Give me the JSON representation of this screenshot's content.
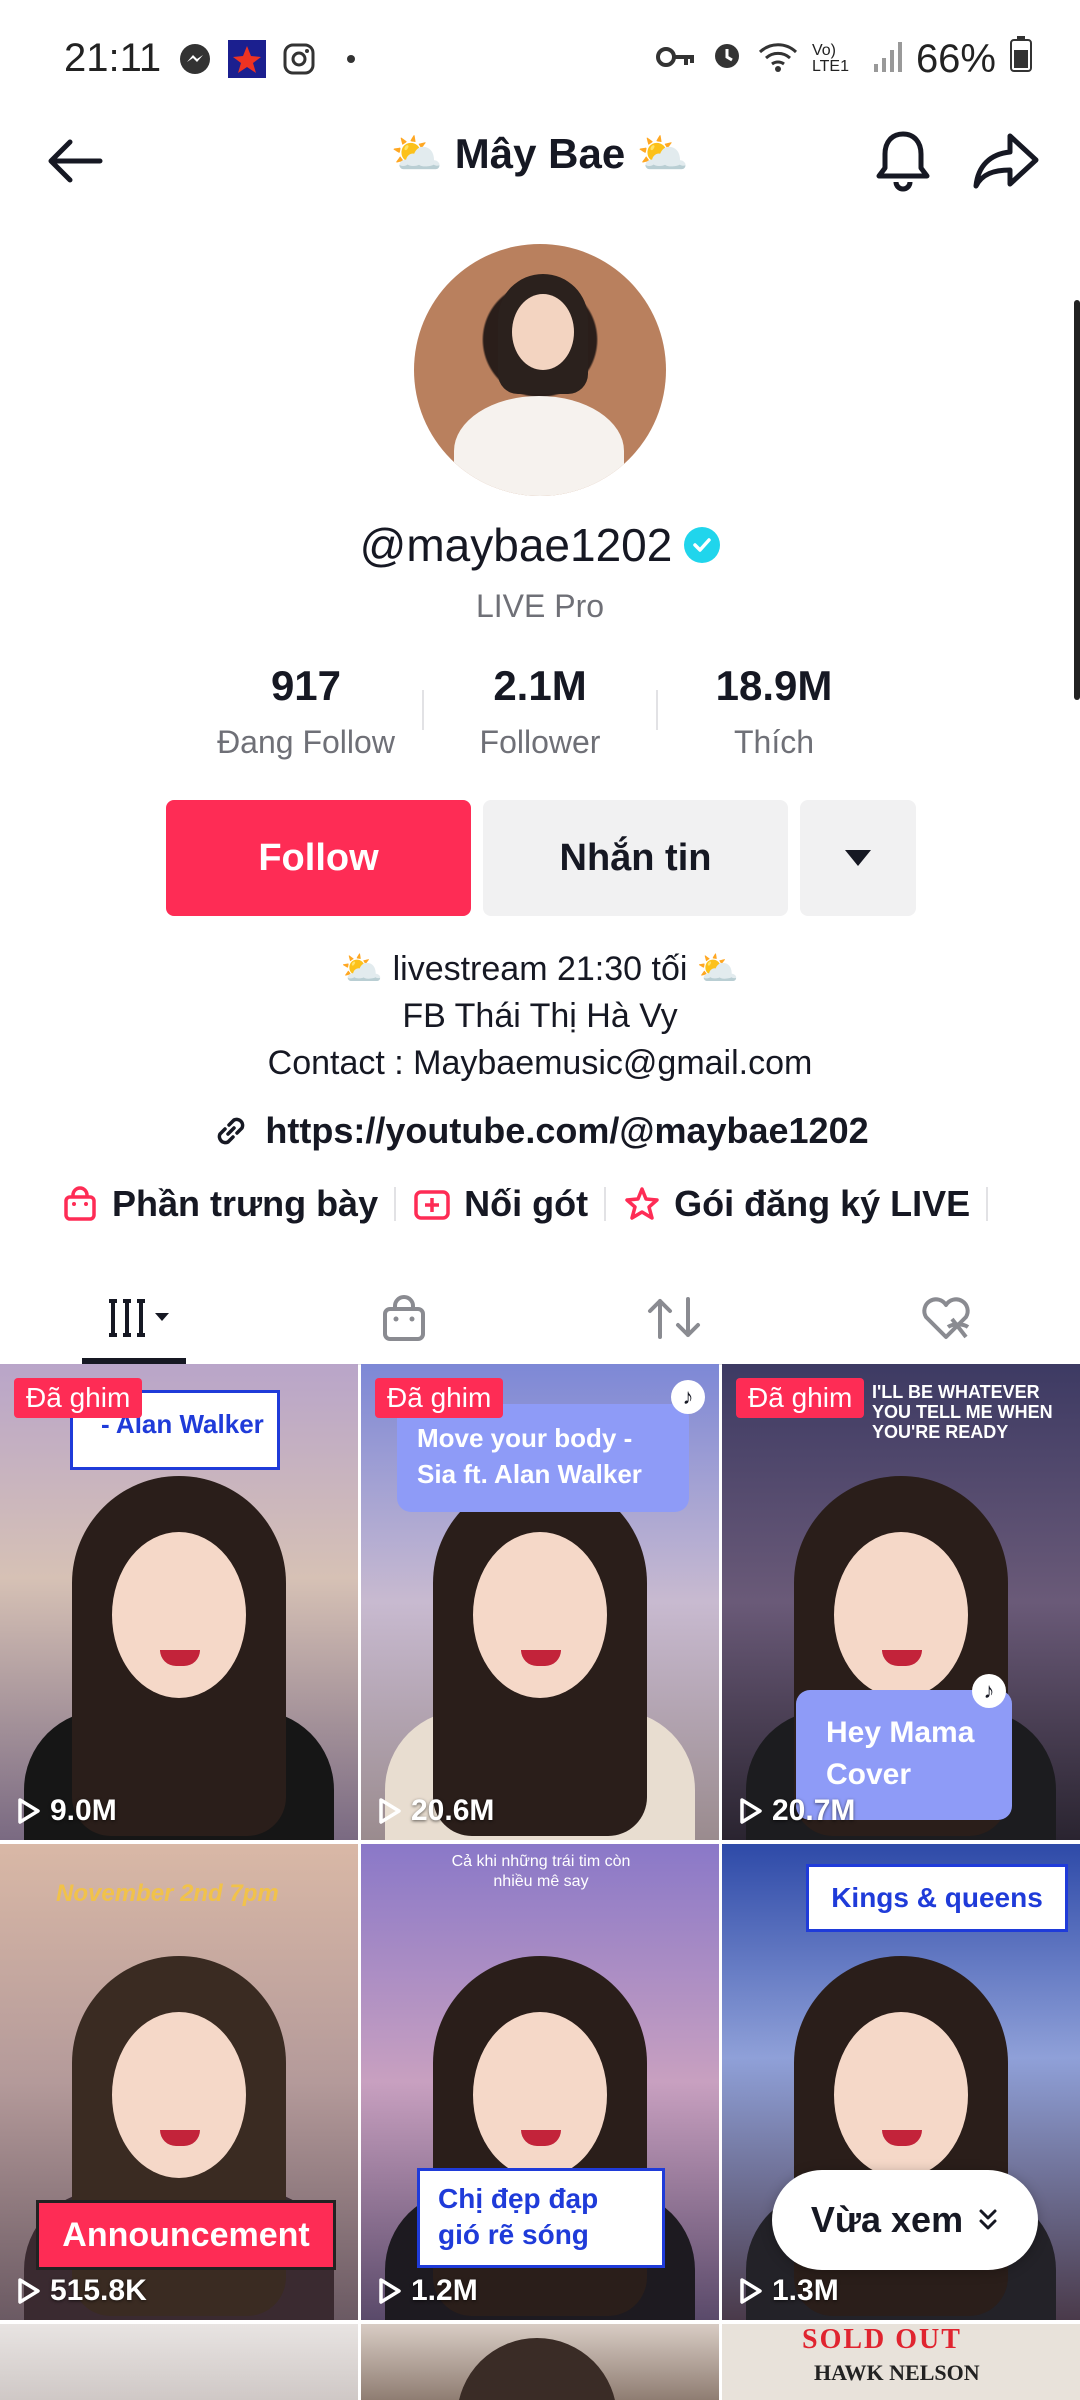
{
  "status_bar": {
    "time": "21:11",
    "battery": "66%",
    "network": "Vo) LTE1"
  },
  "header": {
    "title": "⛅ Mây Bae ⛅"
  },
  "profile": {
    "username": "@maybae1202",
    "subtitle": "LIVE Pro",
    "stats": [
      {
        "value": "917",
        "label": "Đang Follow"
      },
      {
        "value": "2.1M",
        "label": "Follower"
      },
      {
        "value": "18.9M",
        "label": "Thích"
      }
    ],
    "buttons": {
      "follow": "Follow",
      "message": "Nhắn tin"
    },
    "bio": [
      "⛅ livestream 21:30 tối ⛅",
      "FB Thái Thị Hà Vy",
      "Contact : Maybaemusic@gmail.com"
    ],
    "link": "https://youtube.com/@maybae1202",
    "shortcuts": [
      "Phần trưng bày",
      "Nối gót",
      "Gói đăng ký LIVE"
    ]
  },
  "videos": [
    {
      "pinned": "Đã ghim",
      "views": "9.0M",
      "caption": "- Alan Walker"
    },
    {
      "pinned": "Đã ghim",
      "views": "20.6M",
      "caption": "Move your body - Sia ft. Alan Walker"
    },
    {
      "pinned": "Đã ghim",
      "views": "20.7M",
      "caption": "Hey Mama Cover",
      "overlay_text": "I'LL BE WHATEVER YOU TELL ME WHEN YOU'RE READY"
    },
    {
      "views": "515.8K",
      "caption": "Announcement",
      "overlay_text": "November 2nd 7pm"
    },
    {
      "views": "1.2M",
      "caption": "Chị đẹp đạp gió rẽ sóng",
      "overlay_text": "Cả khi những trái tim còn nhiều mê say"
    },
    {
      "views": "1.3M",
      "caption": "Kings & queens"
    },
    {
      "caption": "SOLD OUT",
      "overlay_text": "HAWK NELSON"
    }
  ],
  "recent_button": "Vừa xem",
  "colors": {
    "accent": "#fe2c55",
    "verified": "#20d5ec"
  }
}
